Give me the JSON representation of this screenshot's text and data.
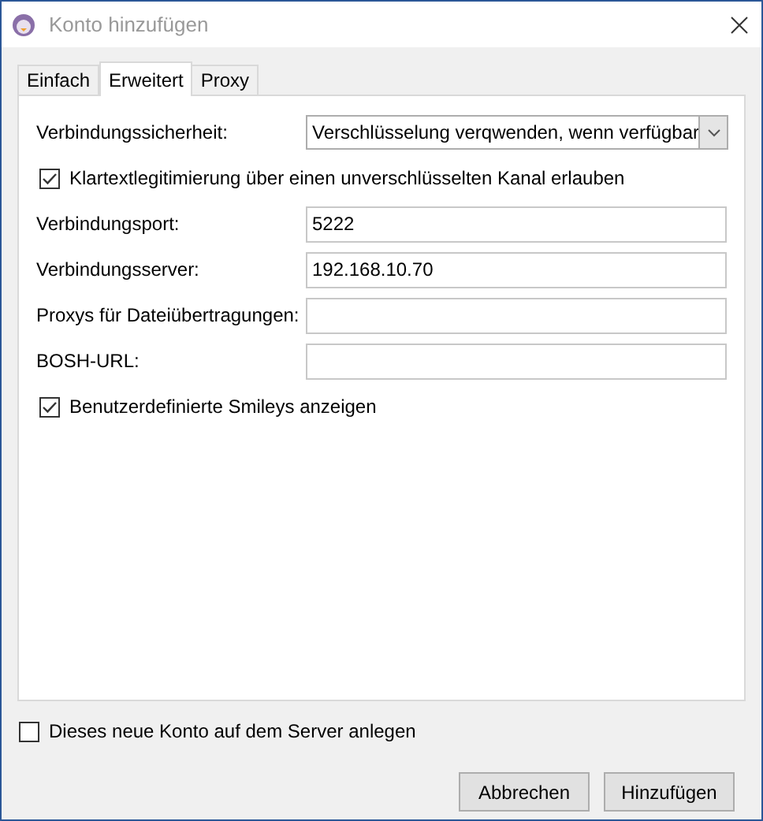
{
  "window": {
    "title": "Konto hinzufügen"
  },
  "tabs": [
    {
      "label": "Einfach",
      "selected": false
    },
    {
      "label": "Erweitert",
      "selected": true
    },
    {
      "label": "Proxy",
      "selected": false
    }
  ],
  "form": [
    {
      "kind": "select",
      "label": "Verbindungssicherheit:",
      "value": "Verschlüsselung verqwenden, wenn verfügbar"
    },
    {
      "kind": "checkbox",
      "label": "Klartextlegitimierung über einen unverschlüsselten Kanal erlauben",
      "checked": true
    },
    {
      "kind": "field",
      "label": "Verbindungsport:",
      "value": "5222"
    },
    {
      "kind": "field",
      "label": "Verbindungsserver:",
      "value": "192.168.10.70"
    },
    {
      "kind": "field",
      "label": "Proxys für Dateiübertragungen:"
    },
    {
      "kind": "field",
      "label": "BOSH-URL:"
    },
    {
      "kind": "checkbox",
      "label": "Benutzerdefinierte Smileys anzeigen",
      "checked": true
    }
  ],
  "register": {
    "label": "Dieses neue Konto auf dem Server anlegen",
    "checked": false
  },
  "buttons": [
    "Abbrechen",
    "Hinzufügen"
  ]
}
